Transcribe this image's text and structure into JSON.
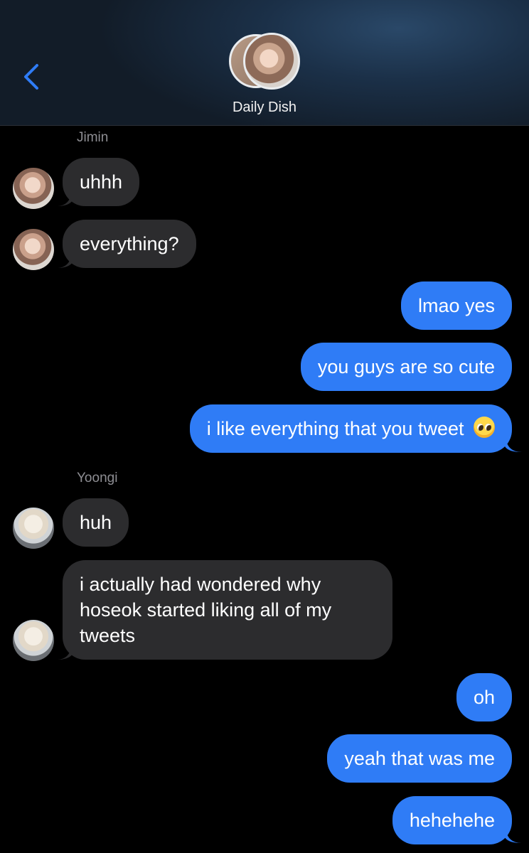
{
  "header": {
    "group_name": "Daily Dish"
  },
  "icons": {
    "back": "chevron-left-icon",
    "avatars": "group-avatar-stack"
  },
  "colors": {
    "accent": "#2f7cf6",
    "incoming_bubble": "#2c2c2e",
    "background": "#000000"
  },
  "thread": {
    "jimin_name": "Jimin",
    "yoongi_name": "Yoongi",
    "messages": [
      "uhhh",
      "everything?",
      "lmao yes",
      "you guys are so cute",
      "i like everything that you tweet",
      "huh",
      "i actually had wondered why",
      "hoseok started liking all of my",
      "tweets",
      "oh",
      "yeah that was me",
      "hehehehe"
    ]
  }
}
